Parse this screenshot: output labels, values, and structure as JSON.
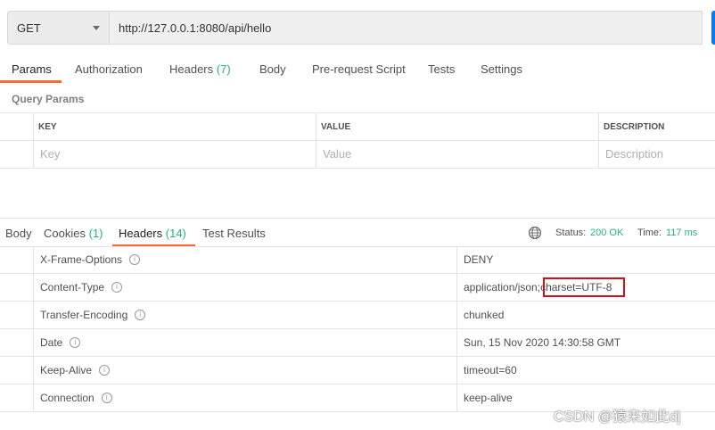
{
  "request": {
    "method": "GET",
    "url": "http://127.0.0.1:8080/api/hello"
  },
  "request_tabs": [
    {
      "label": "Params",
      "count": "",
      "active": true
    },
    {
      "label": "Authorization",
      "count": ""
    },
    {
      "label": "Headers",
      "count": "(7)"
    },
    {
      "label": "Body",
      "count": ""
    },
    {
      "label": "Pre-request Script",
      "count": ""
    },
    {
      "label": "Tests",
      "count": ""
    },
    {
      "label": "Settings",
      "count": ""
    }
  ],
  "query_params": {
    "title": "Query Params",
    "columns": [
      "KEY",
      "VALUE",
      "DESCRIPTION"
    ],
    "placeholders": [
      "Key",
      "Value",
      "Description"
    ]
  },
  "response_tabs": [
    {
      "label": "Body",
      "count": ""
    },
    {
      "label": "Cookies",
      "count": "(1)"
    },
    {
      "label": "Headers",
      "count": "(14)",
      "active": true
    },
    {
      "label": "Test Results",
      "count": ""
    }
  ],
  "status_bar": {
    "status_label": "Status:",
    "status_value": "200 OK",
    "time_label": "Time:",
    "time_value": "117 ms",
    "icon": "globe-icon"
  },
  "response_headers": [
    {
      "key": "X-Frame-Options",
      "value": "DENY"
    },
    {
      "key": "Content-Type",
      "value": "application/json;",
      "value_highlight": "charset=UTF-8"
    },
    {
      "key": "Transfer-Encoding",
      "value": "chunked"
    },
    {
      "key": "Date",
      "value": "Sun, 15 Nov 2020 14:30:58 GMT"
    },
    {
      "key": "Keep-Alive",
      "value": "timeout=60"
    },
    {
      "key": "Connection",
      "value": "keep-alive"
    }
  ],
  "colors": {
    "accent": "#f26b3a",
    "count_green": "#26b47f",
    "highlight_red": "#d0101b",
    "send_blue": "#097bed"
  },
  "watermark": "CSDN @猿来如此dj"
}
